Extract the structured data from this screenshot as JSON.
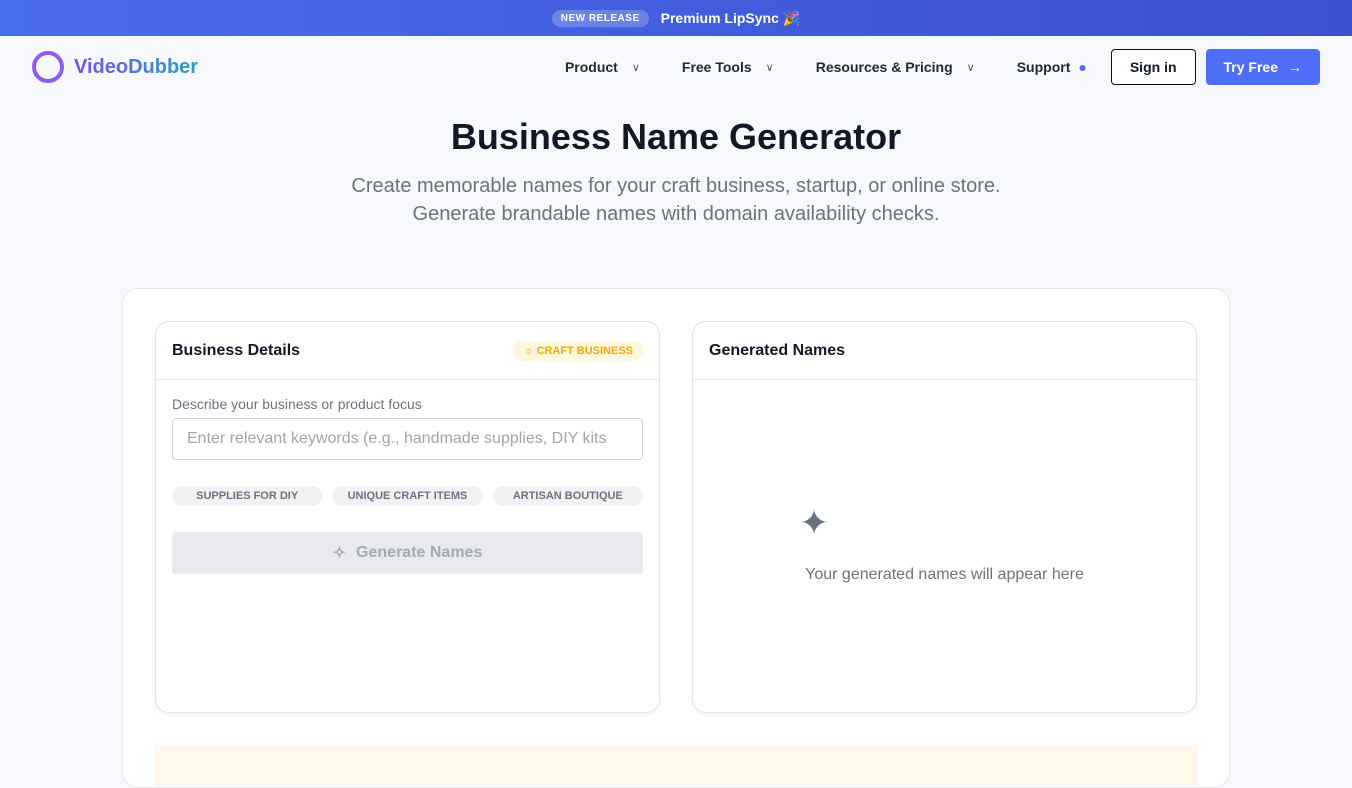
{
  "banner": {
    "badge": "NEW RELEASE",
    "text": "Premium LipSync 🎉"
  },
  "nav": {
    "logo": "VideoDubber",
    "items": [
      "Product",
      "Free Tools",
      "Resources & Pricing"
    ],
    "support": "Support",
    "signin": "Sign in",
    "try": "Try Free"
  },
  "hero": {
    "title": "Business Name Generator",
    "subtitle": "Create memorable names for your craft business, startup, or online store. Generate brandable names with domain availability checks."
  },
  "details": {
    "title": "Business Details",
    "tag": "CRAFT BUSINESS",
    "label": "Describe your business or product focus",
    "placeholder": "Enter relevant keywords (e.g., handmade supplies, DIY kits",
    "chips": [
      "SUPPLIES FOR DIY",
      "UNIQUE CRAFT ITEMS",
      "ARTISAN BOUTIQUE"
    ],
    "generate": "Generate Names"
  },
  "results": {
    "title": "Generated Names",
    "empty": "Your generated names will appear here"
  }
}
